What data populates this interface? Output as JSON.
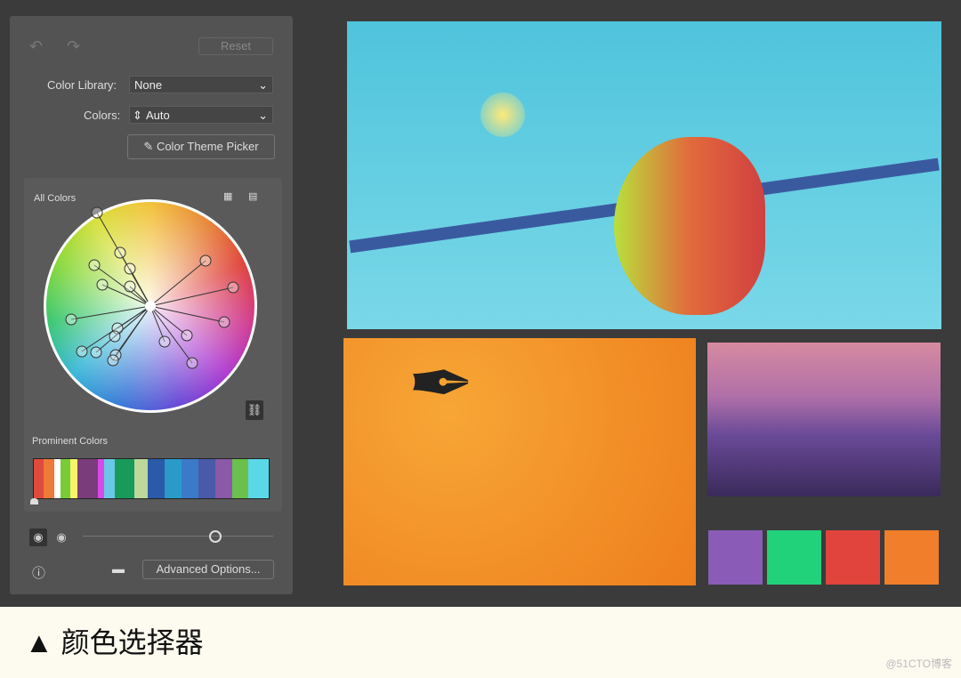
{
  "panel": {
    "reset_label": "Reset",
    "color_library_label": "Color Library:",
    "color_library_value": "None",
    "colors_label": "Colors:",
    "colors_value": "Auto",
    "theme_picker_label": "Color Theme Picker",
    "all_colors_label": "All Colors",
    "prominent_colors_label": "Prominent Colors",
    "advanced_options_label": "Advanced Options...",
    "prominent_colors": [
      "#e04a3c",
      "#ee7a3a",
      "#ffffff",
      "#7acb3a",
      "#f6f46a",
      "#7a3c7a",
      "#d84ae8",
      "#6ac8e6",
      "#1a9a5a",
      "#bcd89a",
      "#2a5aa8",
      "#2a9ac8",
      "#3a7ac8",
      "#4a5aa8",
      "#8a5aa8",
      "#6ac04a",
      "#5ad8e8"
    ]
  },
  "artwork": {
    "swatches": [
      "#8a5cb8",
      "#22d27a",
      "#e0443c",
      "#f07e2a"
    ]
  },
  "caption": "▲ 颜色选择器",
  "watermark": "@51CTO博客"
}
